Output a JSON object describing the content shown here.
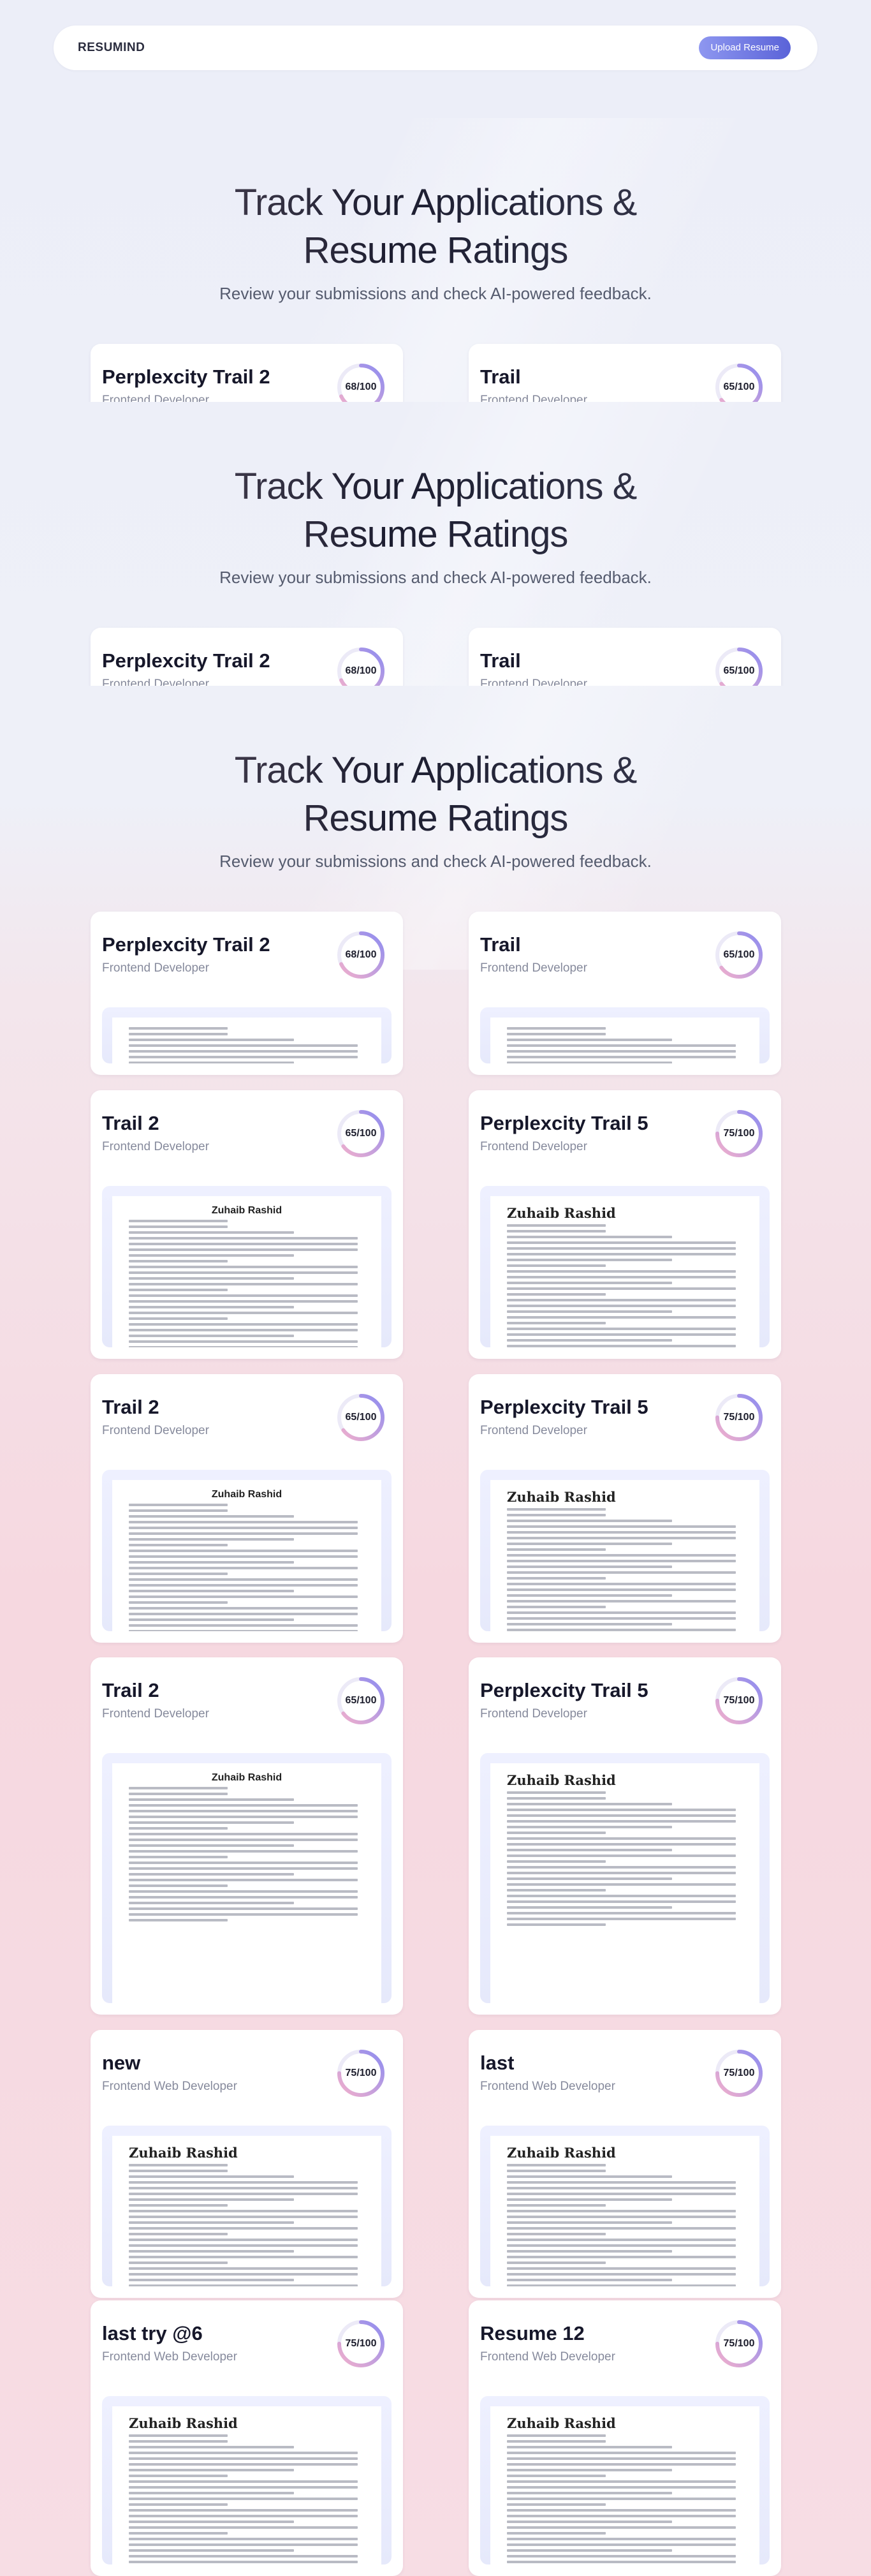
{
  "nav": {
    "logo": "RESUMIND",
    "upload_label": "Upload Resume"
  },
  "hero": {
    "title_line1": "Track Your Applications &",
    "title_line2": "Resume Ratings",
    "subtitle": "Review your submissions and check AI-powered feedback."
  },
  "cards": [
    {
      "title": "Perplexcity Trail 2",
      "role": "Frontend Developer",
      "score_label": "68/100",
      "score": 68
    },
    {
      "title": "Trail",
      "role": "Frontend Developer",
      "score_label": "65/100",
      "score": 65
    },
    {
      "title": "Trail 2",
      "role": "Frontend Developer",
      "score_label": "65/100",
      "score": 65,
      "doc_name": "Zuhaib Rashid"
    },
    {
      "title": "Perplexcity Trail 5",
      "role": "Frontend Developer",
      "score_label": "75/100",
      "score": 75,
      "doc_name": "Zuhaib Rashid"
    },
    {
      "title": "Trail 2",
      "role": "Frontend Developer",
      "score_label": "65/100",
      "score": 65,
      "doc_name": "Zuhaib Rashid"
    },
    {
      "title": "Perplexcity Trail 5",
      "role": "Frontend Developer",
      "score_label": "75/100",
      "score": 75,
      "doc_name": "Zuhaib Rashid"
    },
    {
      "title": "Trail 2",
      "role": "Frontend Developer",
      "score_label": "65/100",
      "score": 65,
      "doc_name": "Zuhaib Rashid"
    },
    {
      "title": "Perplexcity Trail 5",
      "role": "Frontend Developer",
      "score_label": "75/100",
      "score": 75,
      "doc_name": "Zuhaib Rashid"
    },
    {
      "title": "new",
      "role": "Frontend Web Developer",
      "score_label": "75/100",
      "score": 75,
      "doc_name": "Zuhaib Rashid"
    },
    {
      "title": "last",
      "role": "Frontend Web Developer",
      "score_label": "75/100",
      "score": 75,
      "doc_name": "Zuhaib Rashid"
    },
    {
      "title": "last try @6",
      "role": "Frontend Web Developer",
      "score_label": "75/100",
      "score": 75,
      "doc_name": "Zuhaib Rashid"
    },
    {
      "title": "Resume 12",
      "role": "Frontend Web Developer",
      "score_label": "75/100",
      "score": 75,
      "doc_name": "Zuhaib Rashid"
    }
  ],
  "colors": {
    "ring_start": "#f3b0cc",
    "ring_end": "#8e8cf0",
    "ring_track": "#eceaf7",
    "accent": "#6a72e2"
  }
}
